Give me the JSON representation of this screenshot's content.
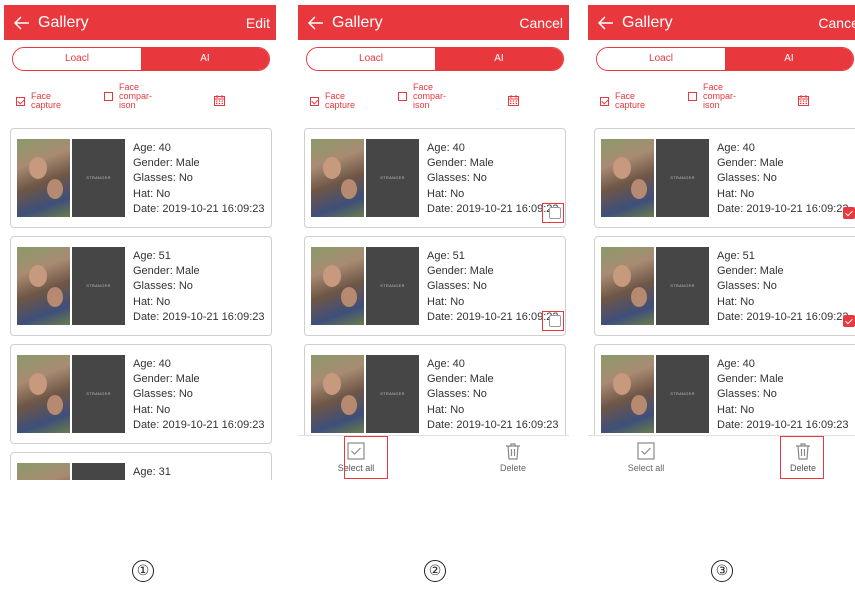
{
  "screens": [
    {
      "header": {
        "title": "Gallery",
        "action": "Edit"
      },
      "tabs": {
        "local": "Loacl",
        "ai": "AI"
      },
      "filters": {
        "capture": "Face capture",
        "compare": "Face compar- ison"
      },
      "cards": [
        {
          "stranger": "STRANGER",
          "age": "Age: 40",
          "gender": "Gender: Male",
          "glasses": "Glasses: No",
          "hat": "Hat: No",
          "date": "Date: 2019-10-21 16:09:23"
        },
        {
          "stranger": "STRANGER",
          "age": "Age: 51",
          "gender": "Gender: Male",
          "glasses": "Glasses: No",
          "hat": "Hat: No",
          "date": "Date: 2019-10-21 16:09:23"
        },
        {
          "stranger": "STRANGER",
          "age": "Age: 40",
          "gender": "Gender: Male",
          "glasses": "Glasses: No",
          "hat": "Hat: No",
          "date": "Date: 2019-10-21 16:09:23"
        },
        {
          "stranger": "",
          "age": "Age: 31",
          "gender": "",
          "glasses": "",
          "hat": "",
          "date": ""
        }
      ]
    },
    {
      "header": {
        "title": "Gallery",
        "action": "Cancel"
      },
      "tabs": {
        "local": "Loacl",
        "ai": "AI"
      },
      "filters": {
        "capture": "Face capture",
        "compare": "Face compar- ison"
      },
      "cards": [
        {
          "stranger": "STRANGER",
          "age": "Age: 40",
          "gender": "Gender: Male",
          "glasses": "Glasses: No",
          "hat": "Hat: No",
          "date": "Date: 2019-10-21 16:09:23",
          "selected": false
        },
        {
          "stranger": "STRANGER",
          "age": "Age: 51",
          "gender": "Gender: Male",
          "glasses": "Glasses: No",
          "hat": "Hat: No",
          "date": "Date: 2019-10-21 16:09:23",
          "selected": false
        },
        {
          "stranger": "STRANGER",
          "age": "Age: 40",
          "gender": "Gender: Male",
          "glasses": "Glasses: No",
          "hat": "Hat: No",
          "date": "Date: 2019-10-21 16:09:23",
          "selected": false
        }
      ],
      "bottom_bar": {
        "select_all": "Select all",
        "delete": "Delete"
      }
    },
    {
      "header": {
        "title": "Gallery",
        "action": "Cancel"
      },
      "tabs": {
        "local": "Loacl",
        "ai": "AI"
      },
      "filters": {
        "capture": "Face capture",
        "compare": "Face compar- ison"
      },
      "cards": [
        {
          "stranger": "STRANGER",
          "age": "Age: 40",
          "gender": "Gender: Male",
          "glasses": "Glasses: No",
          "hat": "Hat: No",
          "date": "Date: 2019-10-21 16:09:23",
          "selected": true
        },
        {
          "stranger": "STRANGER",
          "age": "Age: 51",
          "gender": "Gender: Male",
          "glasses": "Glasses: No",
          "hat": "Hat: No",
          "date": "Date: 2019-10-21 16:09:23",
          "selected": true
        },
        {
          "stranger": "STRANGER",
          "age": "Age: 40",
          "gender": "Gender: Male",
          "glasses": "Glasses: No",
          "hat": "Hat: No",
          "date": "Date: 2019-10-21 16:09:23",
          "selected": false
        }
      ],
      "bottom_bar": {
        "select_all": "Select all",
        "delete": "Delete"
      }
    }
  ],
  "step_labels": [
    "①",
    "②",
    "③"
  ],
  "colors": {
    "accent": "#e8383d",
    "card_border": "#cfcfcf",
    "stranger_bg": "#464646"
  }
}
